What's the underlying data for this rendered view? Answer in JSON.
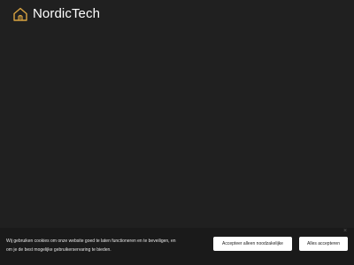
{
  "brand": {
    "name": "NordicTech",
    "logo_icon": "house-icon",
    "accent_color": "#d9a441"
  },
  "cookie_banner": {
    "close_label": "×",
    "text_line1": "Wij gebruiken cookies om onze website goed te laten functioneren en te beveiligen, en",
    "text_line2": "om je de best mogelijke gebruikerservaring te bieden.",
    "accept_necessary_label": "Accepteer alleen noodzakelijke",
    "accept_all_label": "Alles accepteren"
  },
  "colors": {
    "background": "#202020",
    "banner_background": "#1a1a1a",
    "button_background": "#ffffff"
  }
}
